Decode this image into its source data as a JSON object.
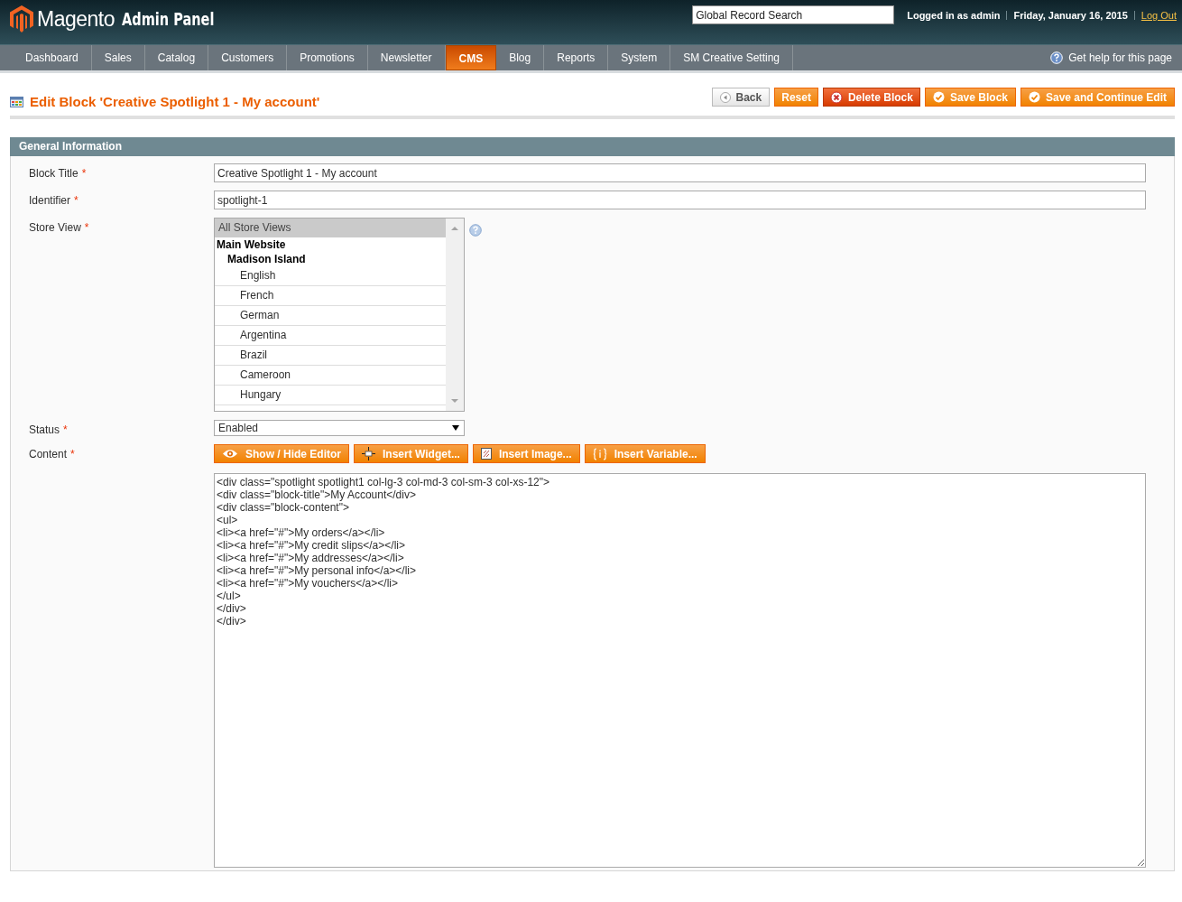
{
  "header": {
    "logo": "Magento",
    "logo_suffix": "Admin Panel",
    "search": {
      "placeholder": "Global Record Search"
    },
    "user": "Logged in as admin",
    "date": "Friday, January 16, 2015",
    "logout": "Log Out"
  },
  "nav": {
    "items": [
      {
        "label": "Dashboard",
        "selected": false
      },
      {
        "label": "Sales",
        "selected": false
      },
      {
        "label": "Catalog",
        "selected": false
      },
      {
        "label": "Customers",
        "selected": false
      },
      {
        "label": "Promotions",
        "selected": false
      },
      {
        "label": "Newsletter",
        "selected": false
      },
      {
        "label": "CMS",
        "selected": true
      },
      {
        "label": "Blog",
        "selected": false
      },
      {
        "label": "Reports",
        "selected": false
      },
      {
        "label": "System",
        "selected": false
      },
      {
        "label": "SM Creative Setting",
        "selected": false
      }
    ],
    "help": "Get help for this page"
  },
  "page": {
    "title": "Edit Block 'Creative Spotlight 1 - My account'",
    "buttons": [
      {
        "label": "Back",
        "kind": "back"
      },
      {
        "label": "Reset",
        "kind": "plain"
      },
      {
        "label": "Delete Block",
        "kind": "delete"
      },
      {
        "label": "Save Block",
        "kind": "save"
      },
      {
        "label": "Save and Continue Edit",
        "kind": "save"
      }
    ]
  },
  "fieldset": {
    "title": "General Information",
    "block_title": {
      "label": "Block Title",
      "marker": "*",
      "value": "Creative Spotlight 1 - My account"
    },
    "identifier": {
      "label": "Identifier",
      "marker": "*",
      "value": "spotlight-1"
    },
    "store_view": {
      "label": "Store View",
      "marker": "*",
      "options": [
        {
          "label": "All Store Views",
          "kind": "option",
          "selected": true
        },
        {
          "label": "Main Website",
          "kind": "group",
          "selected": false
        },
        {
          "label": "Madison Island",
          "kind": "subgroup",
          "selected": false
        },
        {
          "label": "English",
          "kind": "store",
          "selected": false
        },
        {
          "label": "French",
          "kind": "store",
          "selected": false
        },
        {
          "label": "German",
          "kind": "store",
          "selected": false
        },
        {
          "label": "Argentina",
          "kind": "store",
          "selected": false
        },
        {
          "label": "Brazil",
          "kind": "store",
          "selected": false
        },
        {
          "label": "Cameroon",
          "kind": "store",
          "selected": false
        },
        {
          "label": "Hungary",
          "kind": "store",
          "selected": false
        }
      ]
    },
    "status": {
      "label": "Status",
      "marker": "*",
      "value": "Enabled"
    },
    "content": {
      "label": "Content",
      "marker": "*",
      "buttons": [
        {
          "label": "Show / Hide Editor",
          "kind": "eye"
        },
        {
          "label": "Insert Widget...",
          "kind": "widget"
        },
        {
          "label": "Insert Image...",
          "kind": "image"
        },
        {
          "label": "Insert Variable...",
          "kind": "variable"
        }
      ],
      "value": "<div class=\"spotlight spotlight1 col-lg-3 col-md-3 col-sm-3 col-xs-12\">\n<div class=\"block-title\">My Account</div>\n<div class=\"block-content\">\n<ul>\n<li><a href=\"#\">My orders</a></li>\n<li><a href=\"#\">My credit slips</a></li>\n<li><a href=\"#\">My addresses</a></li>\n<li><a href=\"#\">My personal info</a></li>\n<li><a href=\"#\">My vouchers</a></li>\n</ul>\n</div>\n</div>"
    }
  }
}
